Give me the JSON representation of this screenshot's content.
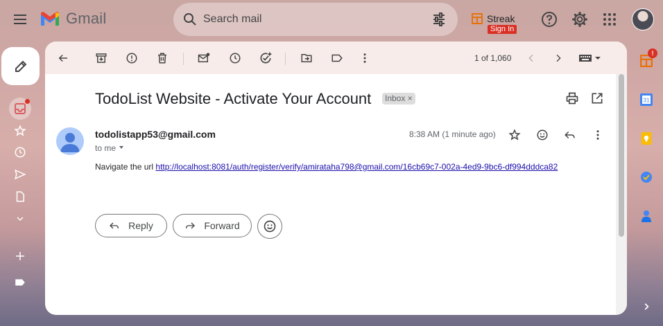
{
  "app": {
    "name": "Gmail"
  },
  "search": {
    "placeholder": "Search mail"
  },
  "streak": {
    "label": "Streak",
    "signin": "Sign In"
  },
  "toolbar": {
    "pager": "1 of 1,060"
  },
  "email": {
    "subject": "TodoList Website - Activate Your Account",
    "label": "Inbox",
    "label_close": "×",
    "sender": "todolistapp53@gmail.com",
    "to": "to me",
    "time": "8:38 AM (1 minute ago)",
    "body_prefix": "Navigate the url",
    "link": "http://localhost:8081/auth/register/verify/amirataha798@gmail.com/16cb69c7-002a-4ed9-9bc6-df994dddca82"
  },
  "actions": {
    "reply": "Reply",
    "forward": "Forward"
  },
  "right_rail": {
    "badge": "!",
    "calendar_day": "31"
  },
  "colors": {
    "gmail_red": "#ea4335",
    "gmail_blue": "#4285f4",
    "gmail_green": "#34a853",
    "gmail_yellow": "#fbbc04",
    "link": "#1a0dab"
  },
  "icons": [
    "menu-icon",
    "gmail-logo",
    "search-icon",
    "tune-icon",
    "streak-icon",
    "help-icon",
    "settings-icon",
    "apps-icon",
    "pencil-icon",
    "inbox-icon",
    "star-icon",
    "clock-icon",
    "send-icon",
    "draft-icon",
    "chevron-down-icon",
    "plus-icon",
    "label-icon",
    "back-arrow-icon",
    "archive-icon",
    "report-spam-icon",
    "delete-icon",
    "mark-unread-icon",
    "snooze-icon",
    "add-task-icon",
    "move-to-icon",
    "labels-icon",
    "more-vert-icon",
    "prev-icon",
    "next-icon",
    "keyboard-icon",
    "print-icon",
    "open-new-window-icon",
    "emoji-icon",
    "reply-icon",
    "forward-icon",
    "calendar-icon",
    "keep-icon",
    "tasks-icon",
    "contacts-icon"
  ]
}
